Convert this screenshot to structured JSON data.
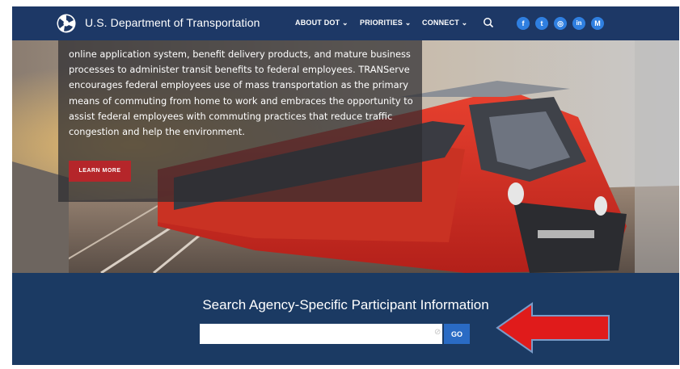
{
  "header": {
    "title": "U.S. Department of Transportation",
    "nav": [
      "ABOUT DOT ⌄",
      "PRIORITIES ⌄",
      "CONNECT ⌄"
    ],
    "social": [
      "f",
      "t",
      "◎",
      "in",
      "M"
    ]
  },
  "hero": {
    "paragraph": "online application system,  benefit delivery products, and mature business processes to administer transit benefits to federal employees.  TRANServe encourages federal employees use of mass transportation as the primary means of commuting from home to work and embraces the opportunity to assist federal employees with commuting practices that reduce traffic congestion and help the environment.",
    "button": "LEARN MORE"
  },
  "search": {
    "heading": "Search Agency-Specific Participant Information",
    "value": "",
    "clear": "⊘",
    "button": "GO"
  },
  "colors": {
    "navbar": "#1d3866",
    "section": "#1b3a63",
    "learn_button": "#b5262a",
    "go_button": "#2a6bc4",
    "arrow": "#e01b1b"
  }
}
